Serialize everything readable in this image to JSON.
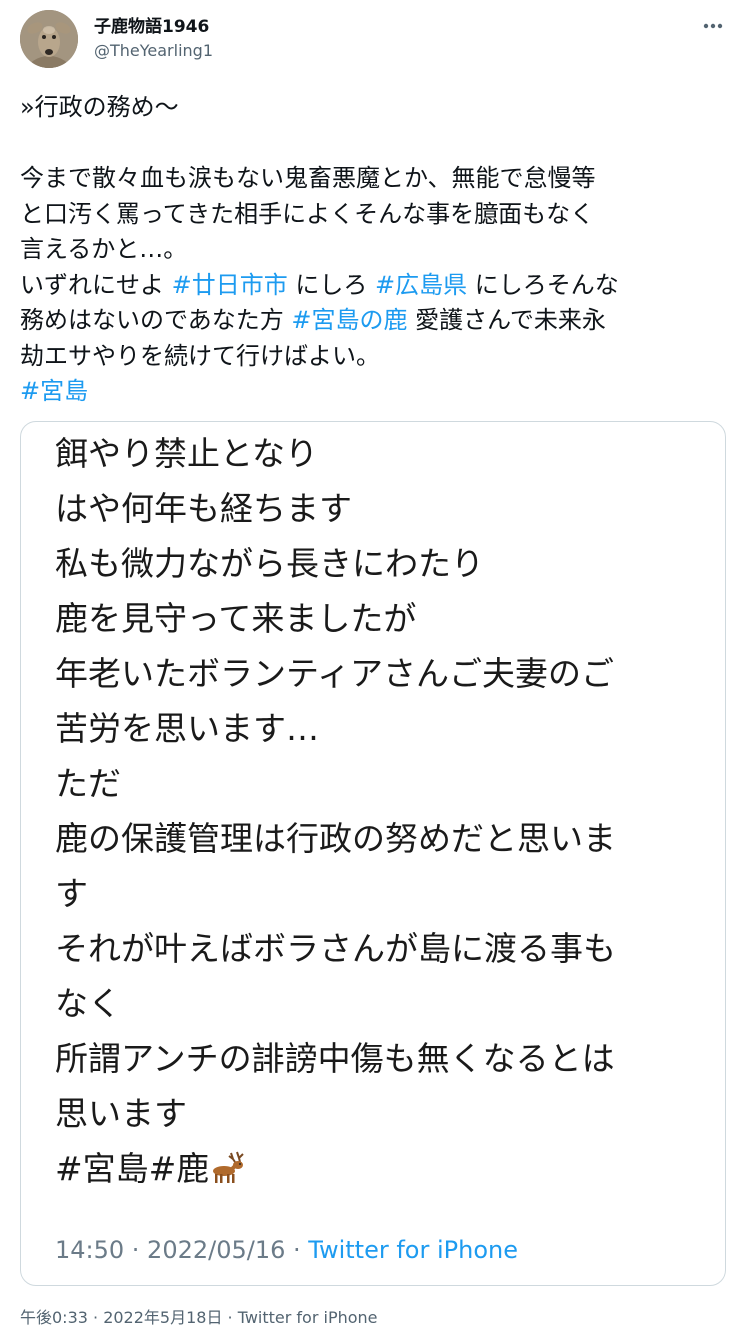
{
  "author": {
    "display_name": "子鹿物語1946",
    "handle": "@TheYearling1",
    "avatar_icon": "deer-photo-avatar",
    "more_icon": "more-options-icon"
  },
  "tweet": {
    "lines": [
      [
        {
          "t": "»行政の務め〜",
          "tag": false
        }
      ],
      [
        {
          "t": "",
          "tag": false
        }
      ],
      [
        {
          "t": "今まで散々血も涙もない鬼畜悪魔とか、無能で怠慢等",
          "tag": false
        }
      ],
      [
        {
          "t": "と口汚く罵ってきた相手によくそんな事を臆面もなく",
          "tag": false
        }
      ],
      [
        {
          "t": "言えるかと…。",
          "tag": false
        }
      ],
      [
        {
          "t": "いずれにせよ ",
          "tag": false
        },
        {
          "t": "#廿日市市",
          "tag": true
        },
        {
          "t": " にしろ ",
          "tag": false
        },
        {
          "t": "#広島県",
          "tag": true
        },
        {
          "t": " にしろそんな",
          "tag": false
        }
      ],
      [
        {
          "t": "務めはないのであなた方 ",
          "tag": false
        },
        {
          "t": "#宮島の鹿",
          "tag": true
        },
        {
          "t": " 愛護さんで未来永",
          "tag": false
        }
      ],
      [
        {
          "t": "劫エサやりを続けて行けばよい。",
          "tag": false
        }
      ],
      [
        {
          "t": "#宮島",
          "tag": true
        }
      ]
    ],
    "link_color": "#1d9bf0"
  },
  "quoted_image": {
    "lines": [
      "餌やり禁止となり",
      "はや何年も経ちます",
      "私も微力ながら長きにわたり",
      "鹿を見守って来ましたが",
      "年老いたボランティアさんご夫妻のご",
      "苦労を思います…",
      "ただ",
      "鹿の保護管理は行政の努めだと思いま",
      "す",
      "それが叶えばボラさんが島に渡る事も",
      "なく",
      "所謂アンチの誹謗中傷も無くなるとは",
      "思います",
      "#宮島#鹿"
    ],
    "emoji_icon": "deer-emoji-icon",
    "meta_time": "14:50 · 2022/05/16 · ",
    "meta_source": "Twitter for iPhone"
  },
  "footer": {
    "timestamp": "午後0:33 · 2022年5月18日 · Twitter for iPhone"
  }
}
